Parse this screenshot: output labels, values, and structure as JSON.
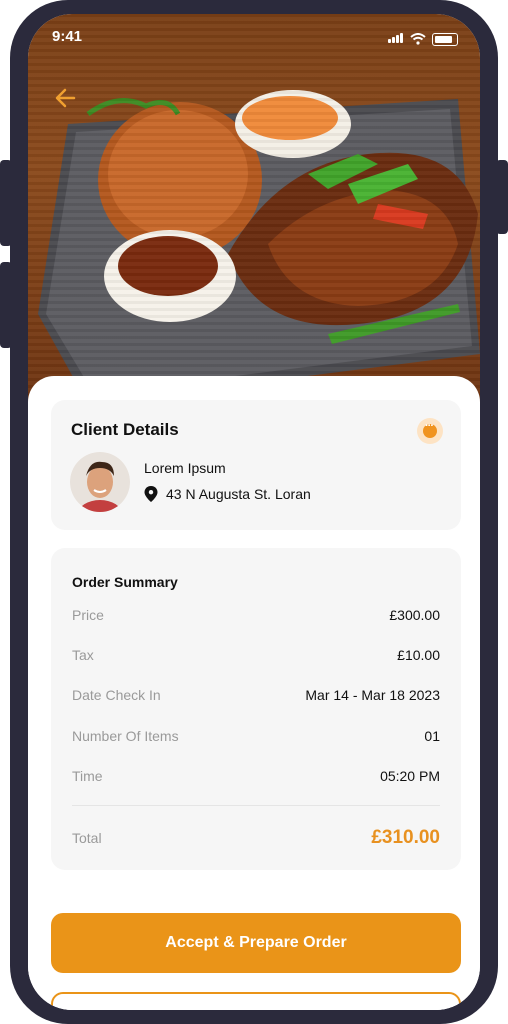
{
  "status_bar": {
    "time": "9:41"
  },
  "client": {
    "title": "Client Details",
    "name": "Lorem Ipsum",
    "address": "43 N Augusta St. Loran"
  },
  "summary": {
    "title": "Order Summary",
    "rows": [
      {
        "label": "Price",
        "value": "£300.00"
      },
      {
        "label": "Tax",
        "value": "£10.00"
      },
      {
        "label": "Date Check In",
        "value": "Mar 14 - Mar 18 2023"
      },
      {
        "label": "Number Of Items",
        "value": "01"
      },
      {
        "label": "Time",
        "value": "05:20 PM"
      }
    ],
    "total_label": "Total",
    "total_value": "£310.00"
  },
  "actions": {
    "primary": "Accept & Prepare Order"
  },
  "colors": {
    "accent": "#ea9418",
    "frame": "#2b2a3c"
  },
  "icons": [
    "back-arrow-icon",
    "chat-icon",
    "location-pin-icon",
    "signal-icon",
    "wifi-icon",
    "battery-icon"
  ]
}
